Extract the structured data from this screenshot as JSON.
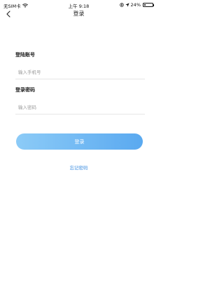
{
  "status_bar": {
    "carrier": "无SIM卡",
    "time": "上午 9:18",
    "battery_percent_label": "24%",
    "battery_level": 0.24
  },
  "nav": {
    "title": "登录"
  },
  "form": {
    "account_label": "登陆账号",
    "phone_placeholder": "输入手机号",
    "password_label": "登录密码",
    "password_placeholder": "输入密码"
  },
  "actions": {
    "login_label": "登录",
    "forgot_label": "忘记密码"
  },
  "icons": {
    "back": "chevron-left-icon",
    "wifi": "wifi-icon",
    "lock_rotation": "lock-icon",
    "location": "location-icon",
    "battery": "battery-icon"
  },
  "colors": {
    "button_start": "#8ccbf7",
    "button_end": "#5aa9f0",
    "link": "#3b8de0",
    "placeholder": "#9a9a9a"
  }
}
